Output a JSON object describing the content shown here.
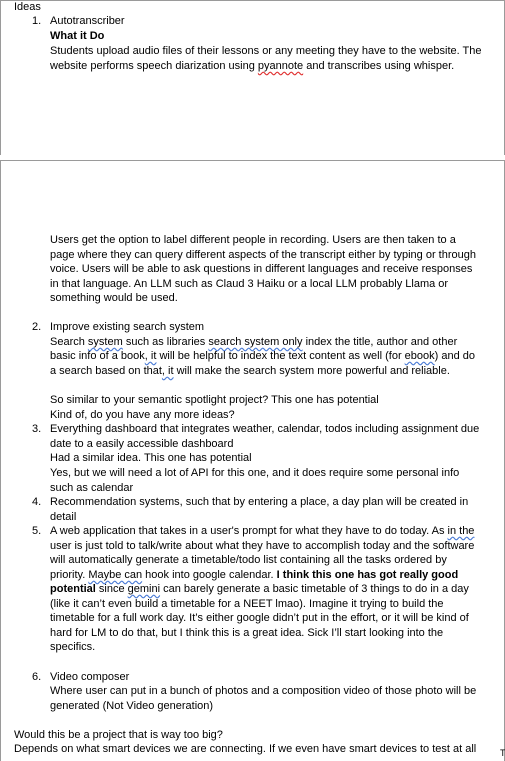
{
  "doc": {
    "heading": "Ideas",
    "items": [
      {
        "num": "1.",
        "title": "Autotranscriber",
        "subhead": "What it Do",
        "p1_l1": "Students upload audio files of their lessons or any meeting they have to the website. The",
        "p1_l2a": "website performs speech diarization using ",
        "p1_l2b": "pyannote",
        "p1_l2c": " and transcribes using whisper.",
        "p2_lines": [
          "Users get the option to label different people in recording. Users are then taken to a",
          "page where they can query different aspects of the transcript either by typing or through",
          "voice. Users will be able to ask questions in different languages and receive responses",
          "in that language. An LLM such as Claud 3 Haiku or a local LLM probably Llama or",
          "something would be used."
        ]
      },
      {
        "num": "2.",
        "title": "Improve existing search system",
        "l1a": "Search ",
        "l1b": "system",
        "l1c": " such as libraries ",
        "l1d": "search system only",
        "l1e": " index the title, author and other",
        "l2a": "basic info of a book",
        "l2b": ", it",
        "l2c": " will be helpful to index the text content as well (for ",
        "l2d": "ebook",
        "l2e": ") and do",
        "l3a": "a search based on that",
        "l3b": ", it",
        "l3c": " will make the search system more powerful and reliable.",
        "c1": "So similar to your semantic spotlight project?  This one has potential",
        "c2": "Kind of, do you have any more ideas?"
      },
      {
        "num": "3.",
        "l1": "Everything dashboard that integrates weather, calendar, todos including assignment due",
        "l2": "date to a easily accessible dashboard",
        "l3": "Had a similar idea. This one has potential",
        "l4": "Yes, but we will need a lot of API for this one, and it does require some personal info",
        "l5": "such as calendar"
      },
      {
        "num": "4.",
        "l1": "Recommendation systems, such that by entering a place, a day plan will be created in",
        "l2": "detail"
      },
      {
        "num": "5.",
        "l1a": "A web application that takes in a user's prompt for what they have to do today. As ",
        "l1b": "in the",
        "l2": "user is just told to talk/write about what they have to accomplish today and the software",
        "l3": "will automatically generate a timetable/todo list containing all the tasks ordered by",
        "l4a": "priority. ",
        "l4b": "Maybe can",
        "l4c": " hook into google calendar.  ",
        "l4d": "I think this one has got really good",
        "l5a": "potential",
        "l5b": " since ",
        "l5c": "gemini",
        "l5d": " can barely generate a basic timetable of 3 things to do in a day",
        "l6": "(like it can’t even build a timetable for a NEET lmao). Imagine it trying to build the",
        "l7": "timetable for a full work day. It’s either google didn’t put in the effort, or it will be kind of",
        "l8": "hard for LM to do that, but I think this is a great idea. Sick I’ll start looking into the",
        "l9": "specifics."
      },
      {
        "num": "6.",
        "title": "Video composer",
        "l1": "Where user can put in a bunch of photos and a composition video of those photo will be",
        "l2": "generated (Not Video generation)"
      }
    ],
    "q1": "Would this be a project that is way too big?",
    "q2": "Depends on what smart devices we are connecting. If we even have smart devices to test at all",
    "cursor": "T"
  }
}
